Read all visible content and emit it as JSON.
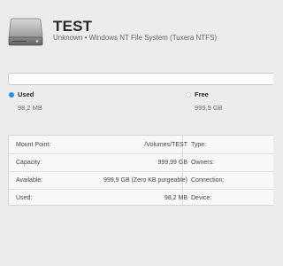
{
  "volume": {
    "name": "TEST",
    "subtitle": "Unknown • Windows NT File System (Tuxera NTFS)"
  },
  "usage": {
    "used_fraction": 0.0001,
    "used_label": "Used",
    "used_value": "98,2 MB",
    "free_label": "Free",
    "free_value": "999,9 GB"
  },
  "info": {
    "left": [
      {
        "label": "Mount Point:",
        "value": "/Volumes/TEST"
      },
      {
        "label": "Capacity:",
        "value": "999,99 GB"
      },
      {
        "label": "Available:",
        "value": "999,9 GB (Zero KB purgeable)"
      },
      {
        "label": "Used:",
        "value": "98,2 MB"
      }
    ],
    "right": [
      {
        "label": "Type:"
      },
      {
        "label": "Owners:"
      },
      {
        "label": "Connection:"
      },
      {
        "label": "Device:"
      }
    ]
  },
  "colors": {
    "used": "#1f8ff0",
    "free": "#ffffff"
  },
  "icons": {
    "disk": "external-disk-icon"
  }
}
